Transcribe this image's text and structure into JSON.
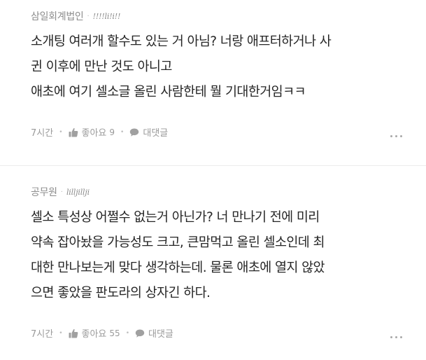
{
  "comments": [
    {
      "author": "삼일회계법인",
      "separator": "·",
      "nickname": "!!!!li!i!!",
      "lines": [
        "소개팅 여러개 할수도 있는 거 아님? 너랑 애프터하거나 사",
        "귄 이후에 만난 것도 아니고",
        "애초에 여기 셀소글 올린 사람한테 뭘 기대한거임ㅋㅋ"
      ],
      "time": "7시간",
      "like_label": "좋아요",
      "like_count": "9",
      "reply_label": "대댓글",
      "icons": {
        "like": "thumbs-up-icon",
        "reply": "speech-bubble-icon",
        "more": "more-dots-icon"
      }
    },
    {
      "author": "공무원",
      "separator": "·",
      "nickname": "lilljillji",
      "lines": [
        "셀소 특성상 어쩔수 없는거 아닌가? 너 만나기 전에 미리",
        "약속 잡아놨을 가능성도 크고, 큰맘먹고 올린 셀소인데 최",
        "대한 만나보는게 맞다 생각하는데. 물론 애초에 열지 않았",
        "으면 좋았을 판도라의 상자긴 하다."
      ],
      "time": "7시간",
      "like_label": "좋아요",
      "like_count": "55",
      "reply_label": "대댓글",
      "icons": {
        "like": "thumbs-up-icon",
        "reply": "speech-bubble-icon",
        "more": "more-dots-icon"
      }
    }
  ],
  "colors": {
    "meta_text": "#9a9a9a",
    "body_text": "#262626",
    "divider": "#ececec"
  }
}
